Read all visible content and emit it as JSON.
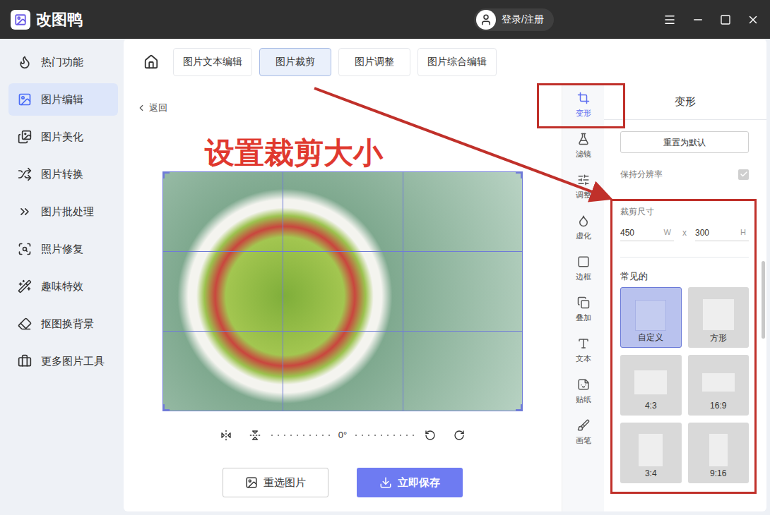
{
  "app": {
    "name": "改图鸭",
    "login": "登录/注册"
  },
  "sidebar": {
    "items": [
      {
        "label": "热门功能",
        "selected": false
      },
      {
        "label": "图片编辑",
        "selected": true
      },
      {
        "label": "图片美化",
        "selected": false
      },
      {
        "label": "图片转换",
        "selected": false
      },
      {
        "label": "图片批处理",
        "selected": false
      },
      {
        "label": "照片修复",
        "selected": false
      },
      {
        "label": "趣味特效",
        "selected": false
      },
      {
        "label": "抠图换背景",
        "selected": false
      },
      {
        "label": "更多图片工具",
        "selected": false
      }
    ]
  },
  "tabs": [
    {
      "label": "图片文本编辑",
      "selected": false
    },
    {
      "label": "图片裁剪",
      "selected": true
    },
    {
      "label": "图片调整",
      "selected": false
    },
    {
      "label": "图片综合编辑",
      "selected": false
    }
  ],
  "canvas": {
    "back": "返回",
    "annotation": "设置裁剪大小",
    "rotation": "0°"
  },
  "buttons": [
    {
      "label": "重选图片",
      "primary": false
    },
    {
      "label": "立即保存",
      "primary": true
    }
  ],
  "tools": [
    {
      "label": "变形",
      "selected": true
    },
    {
      "label": "滤镜",
      "selected": false
    },
    {
      "label": "调整",
      "selected": false
    },
    {
      "label": "虚化",
      "selected": false
    },
    {
      "label": "边框",
      "selected": false
    },
    {
      "label": "叠加",
      "selected": false
    },
    {
      "label": "文本",
      "selected": false
    },
    {
      "label": "贴纸",
      "selected": false
    },
    {
      "label": "画笔",
      "selected": false
    }
  ],
  "panel": {
    "title": "变形",
    "reset": "重置为默认",
    "keep_resolution": {
      "label": "保持分辨率",
      "checked": true
    },
    "crop_size": {
      "label": "裁剪尺寸",
      "width": "450",
      "width_unit": "W",
      "separator": "x",
      "height": "300",
      "height_unit": "H"
    },
    "presets_title": "常见的",
    "presets": [
      {
        "label": "自定义",
        "selected": true
      },
      {
        "label": "方形",
        "selected": false
      },
      {
        "label": "4:3",
        "selected": false
      },
      {
        "label": "16:9",
        "selected": false
      },
      {
        "label": "3:4",
        "selected": false
      },
      {
        "label": "9:16",
        "selected": false
      }
    ]
  }
}
